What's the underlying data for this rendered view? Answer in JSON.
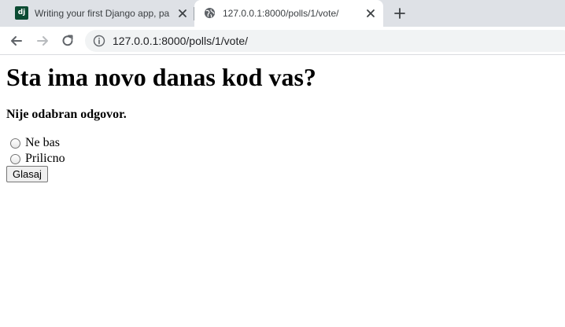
{
  "browser": {
    "tabs": [
      {
        "title": "Writing your first Django app, pa",
        "favicon": "django-icon",
        "favicon_text": "dj",
        "active": false
      },
      {
        "title": "127.0.0.1:8000/polls/1/vote/",
        "favicon": "globe-icon",
        "active": true
      }
    ],
    "url": "127.0.0.1:8000/polls/1/vote/"
  },
  "page": {
    "question": "Sta ima novo danas kod vas?",
    "error_message": "Nije odabran odgovor.",
    "choices": [
      {
        "label": "Ne bas",
        "checked": false
      },
      {
        "label": "Prilicno",
        "checked": false
      }
    ],
    "submit_label": "Glasaj"
  },
  "colors": {
    "tabstrip": "#dee1e6",
    "django_green": "#0c4b33",
    "omnibox": "#f1f3f4"
  }
}
